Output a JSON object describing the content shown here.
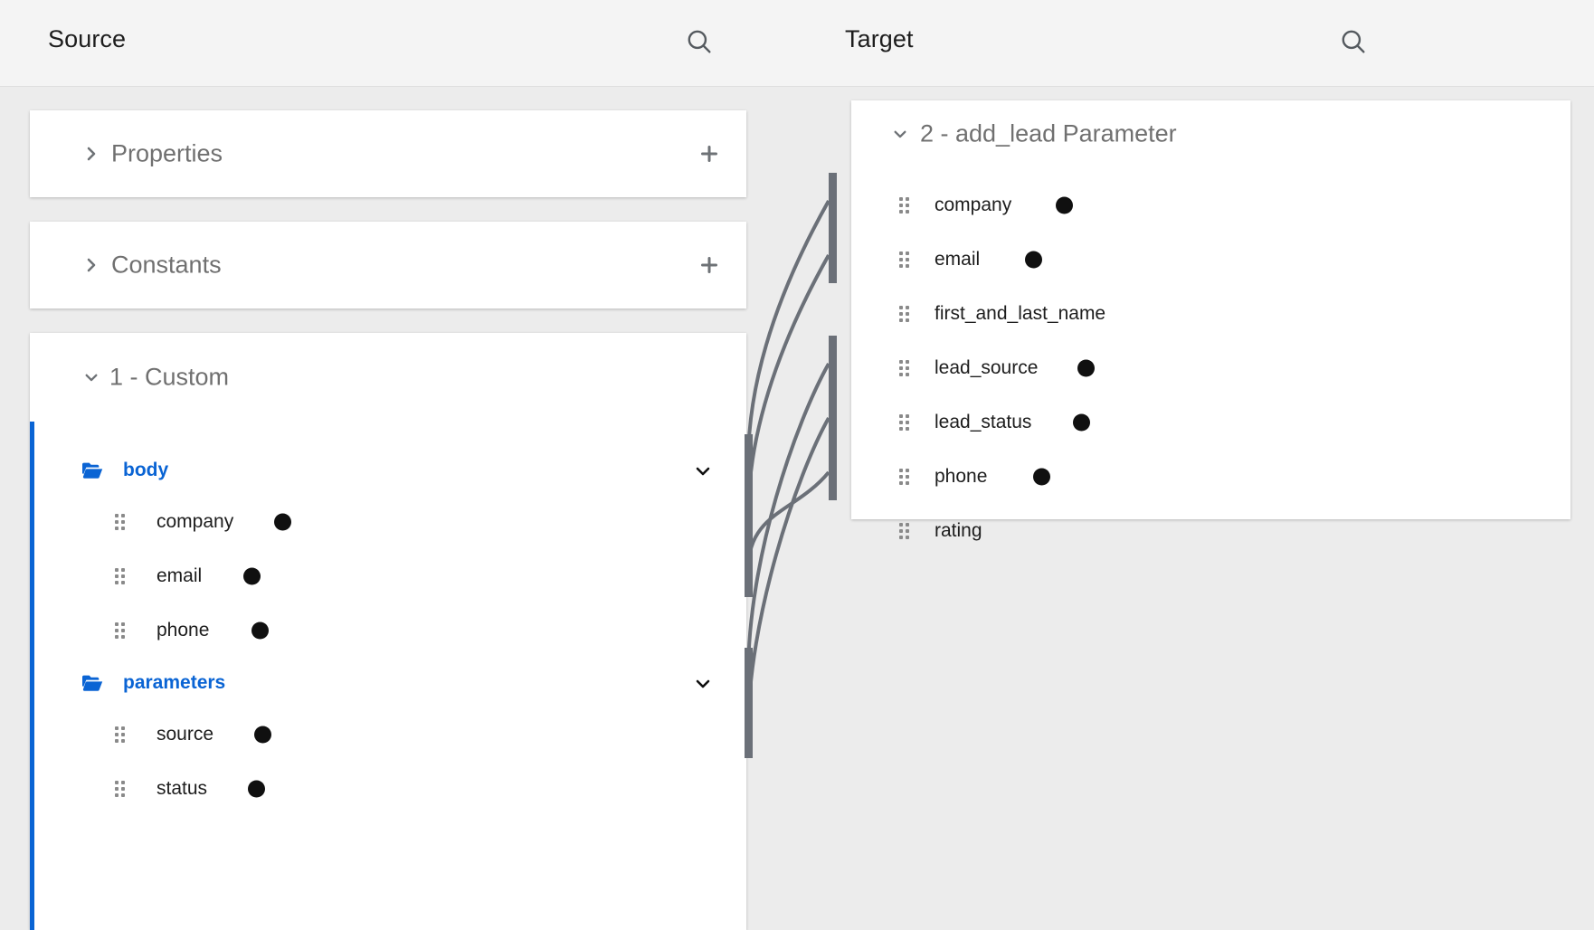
{
  "panes": {
    "source": {
      "title": "Source",
      "search_icon": "search-icon"
    },
    "target": {
      "title": "Target",
      "search_icon": "search-icon"
    }
  },
  "source": {
    "sections": [
      {
        "label": "Properties",
        "expanded": false,
        "chevron": "chevron-right-icon",
        "add_icon": "plus-icon"
      },
      {
        "label": "Constants",
        "expanded": false,
        "chevron": "chevron-right-icon",
        "add_icon": "plus-icon"
      }
    ],
    "custom": {
      "label": "1 - Custom",
      "expanded": true,
      "chevron": "chevron-down-icon",
      "accent_color": "#0a64d4",
      "folders": [
        {
          "name": "body",
          "icon": "folder-open-icon",
          "chevron": "chevron-down-icon",
          "expanded": true,
          "fields": [
            {
              "name": "company",
              "connected": true,
              "handle": "drag-handle-icon"
            },
            {
              "name": "email",
              "connected": true,
              "handle": "drag-handle-icon"
            },
            {
              "name": "phone",
              "connected": true,
              "handle": "drag-handle-icon"
            }
          ]
        },
        {
          "name": "parameters",
          "icon": "folder-open-icon",
          "chevron": "chevron-down-icon",
          "expanded": true,
          "fields": [
            {
              "name": "source",
              "connected": true,
              "handle": "drag-handle-icon"
            },
            {
              "name": "status",
              "connected": true,
              "handle": "drag-handle-icon"
            }
          ]
        }
      ]
    }
  },
  "target": {
    "group": {
      "label": "2 - add_lead Parameter",
      "expanded": true,
      "chevron": "chevron-down-icon",
      "fields": [
        {
          "name": "company",
          "connected": true,
          "handle": "drag-handle-icon"
        },
        {
          "name": "email",
          "connected": true,
          "handle": "drag-handle-icon"
        },
        {
          "name": "first_and_last_name",
          "connected": false,
          "handle": "drag-handle-icon"
        },
        {
          "name": "lead_source",
          "connected": true,
          "handle": "drag-handle-icon"
        },
        {
          "name": "lead_status",
          "connected": true,
          "handle": "drag-handle-icon"
        },
        {
          "name": "phone",
          "connected": true,
          "handle": "drag-handle-icon"
        },
        {
          "name": "rating",
          "connected": false,
          "handle": "drag-handle-icon"
        }
      ]
    }
  },
  "mappings": [
    {
      "from": "body.company",
      "to": "company"
    },
    {
      "from": "body.email",
      "to": "email"
    },
    {
      "from": "body.phone",
      "to": "phone"
    },
    {
      "from": "parameters.source",
      "to": "lead_source"
    },
    {
      "from": "parameters.status",
      "to": "lead_status"
    }
  ],
  "colors": {
    "link": "#6b7078",
    "accent": "#0a64d4",
    "canvas": "#ececec",
    "header": "#f4f4f4",
    "card": "#ffffff"
  }
}
